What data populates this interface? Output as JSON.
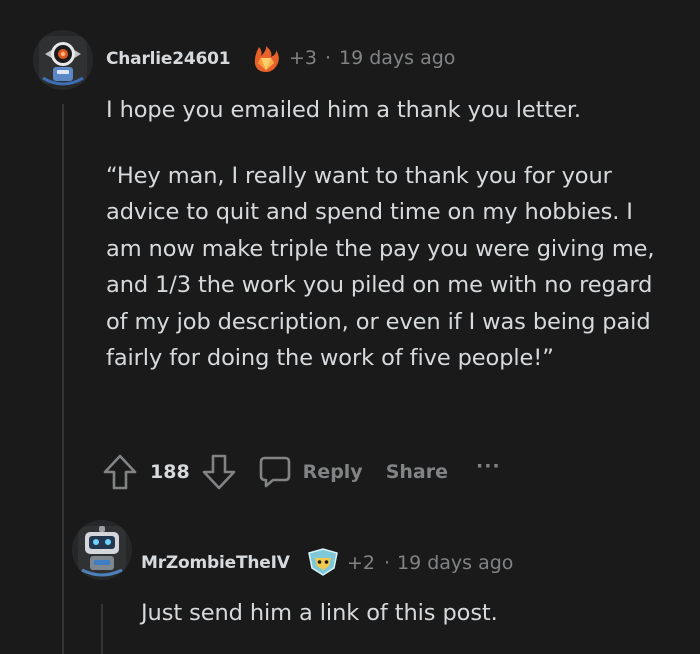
{
  "comment": {
    "username": "Charlie24601",
    "karma_change": "+3",
    "separator": "·",
    "time": "19 days ago",
    "paragraphs": [
      "I hope you emailed him a thank you letter.",
      "“Hey man, I really want to thank you for your advice to quit and spend time on my hobbies. I am now make triple the pay you were giving me, and 1/3 the work you piled on me with no regard of my job description, or even if I was being paid fairly for doing the work of five people!”"
    ],
    "votes": "188",
    "reply_label": "Reply",
    "share_label": "Share",
    "more_label": "···",
    "avatar_icon": "robot-avatar-icon",
    "flair_icon": "fire-gem-flair-icon"
  },
  "reply": {
    "username": "MrZombieTheIV",
    "karma_change": "+2",
    "separator": "·",
    "time": "19 days ago",
    "paragraphs": [
      "Just send him a link of this post."
    ],
    "avatar_icon": "robot-avatar-icon",
    "flair_icon": "gaming-badge-flair-icon"
  },
  "colors": {
    "background": "#1a1a1b",
    "text": "#d7dadc",
    "muted": "#818384",
    "thread": "#343536"
  }
}
